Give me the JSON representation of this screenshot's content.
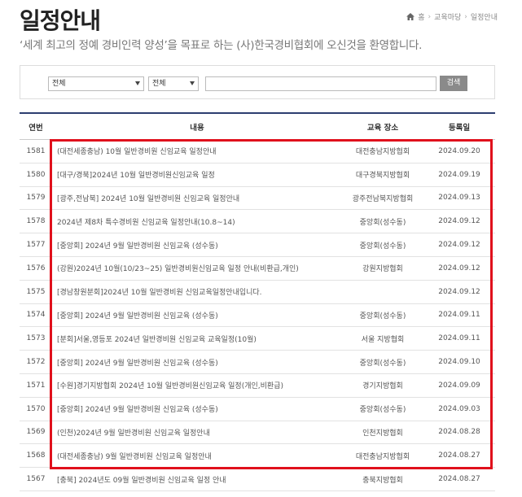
{
  "header": {
    "title": "일정안내",
    "breadcrumb": [
      "홈",
      "교육마당",
      "일정안내"
    ],
    "welcome": "‘세계 최고의 정예 경비인력 양성’을 목표로 하는 (사)한국경비협회에 오신것을 환영합니다."
  },
  "search": {
    "select1_value": "전체",
    "select2_value": "전체",
    "input_value": "",
    "button_label": "검색"
  },
  "table": {
    "columns": {
      "no": "연번",
      "title": "내용",
      "place": "교육 장소",
      "date": "등록일"
    },
    "rows": [
      {
        "no": "1581",
        "title": "(대전세종충남) 10월 일반경비원 신임교육 일정안내",
        "place": "대전충남지방협회",
        "date": "2024.09.20"
      },
      {
        "no": "1580",
        "title": "[대구/경북]2024년 10월 일반경비원신임교육 일정",
        "place": "대구경북지방협회",
        "date": "2024.09.19"
      },
      {
        "no": "1579",
        "title": "[광주,전남북] 2024년 10월 일반경비원 신임교육 일정안내",
        "place": "광주전남북지방협회",
        "date": "2024.09.13"
      },
      {
        "no": "1578",
        "title": "2024년 제8차 특수경비원 신임교육 일정안내(10.8~14)",
        "place": "중앙회(성수동)",
        "date": "2024.09.12"
      },
      {
        "no": "1577",
        "title": "[중앙회] 2024년 9월 일반경비원 신임교육 (성수동)",
        "place": "중앙회(성수동)",
        "date": "2024.09.12"
      },
      {
        "no": "1576",
        "title": "(강원)2024년 10월(10/23~25) 일반경비원신임교육 일정 안내(비환급,개인)",
        "place": "강원지방협회",
        "date": "2024.09.12"
      },
      {
        "no": "1575",
        "title": "[경남창원분회]2024년 10월 일반경비원 신임교육일정안내입니다.",
        "place": "",
        "date": "2024.09.12"
      },
      {
        "no": "1574",
        "title": "[중앙회] 2024년 9월 일반경비원 신임교육 (성수동)",
        "place": "중앙회(성수동)",
        "date": "2024.09.11"
      },
      {
        "no": "1573",
        "title": "[분회]서울,영등포 2024년 일반경비원 신임교육 교육일정(10월)",
        "place": "서울 지방협회",
        "date": "2024.09.11"
      },
      {
        "no": "1572",
        "title": "[중앙회] 2024년 9월 일반경비원 신임교육 (성수동)",
        "place": "중앙회(성수동)",
        "date": "2024.09.10"
      },
      {
        "no": "1571",
        "title": "[수원]경기지방협회 2024년 10월 일반경비원신임교육 일정(개인,비환급)",
        "place": "경기지방협회",
        "date": "2024.09.09"
      },
      {
        "no": "1570",
        "title": "[중앙회] 2024년 9월 일반경비원 신임교육 (성수동)",
        "place": "중앙회(성수동)",
        "date": "2024.09.03"
      },
      {
        "no": "1569",
        "title": "(인천)2024년 9월 일반경비원 신임교육 일정안내",
        "place": "인천지방협회",
        "date": "2024.08.28"
      },
      {
        "no": "1568",
        "title": "(대전세종충남) 9월 일반경비원 신임교육 일정안내",
        "place": "대전충남지방협회",
        "date": "2024.08.27"
      },
      {
        "no": "1567",
        "title": "[충북] 2024년도 09월 일반경비원 신임교육 일정 안내",
        "place": "충북지방협회",
        "date": "2024.08.27"
      }
    ]
  },
  "colors": {
    "table_top_border": "#2c3e70",
    "highlight": "#e0101c",
    "search_button": "#8a8a8a"
  }
}
